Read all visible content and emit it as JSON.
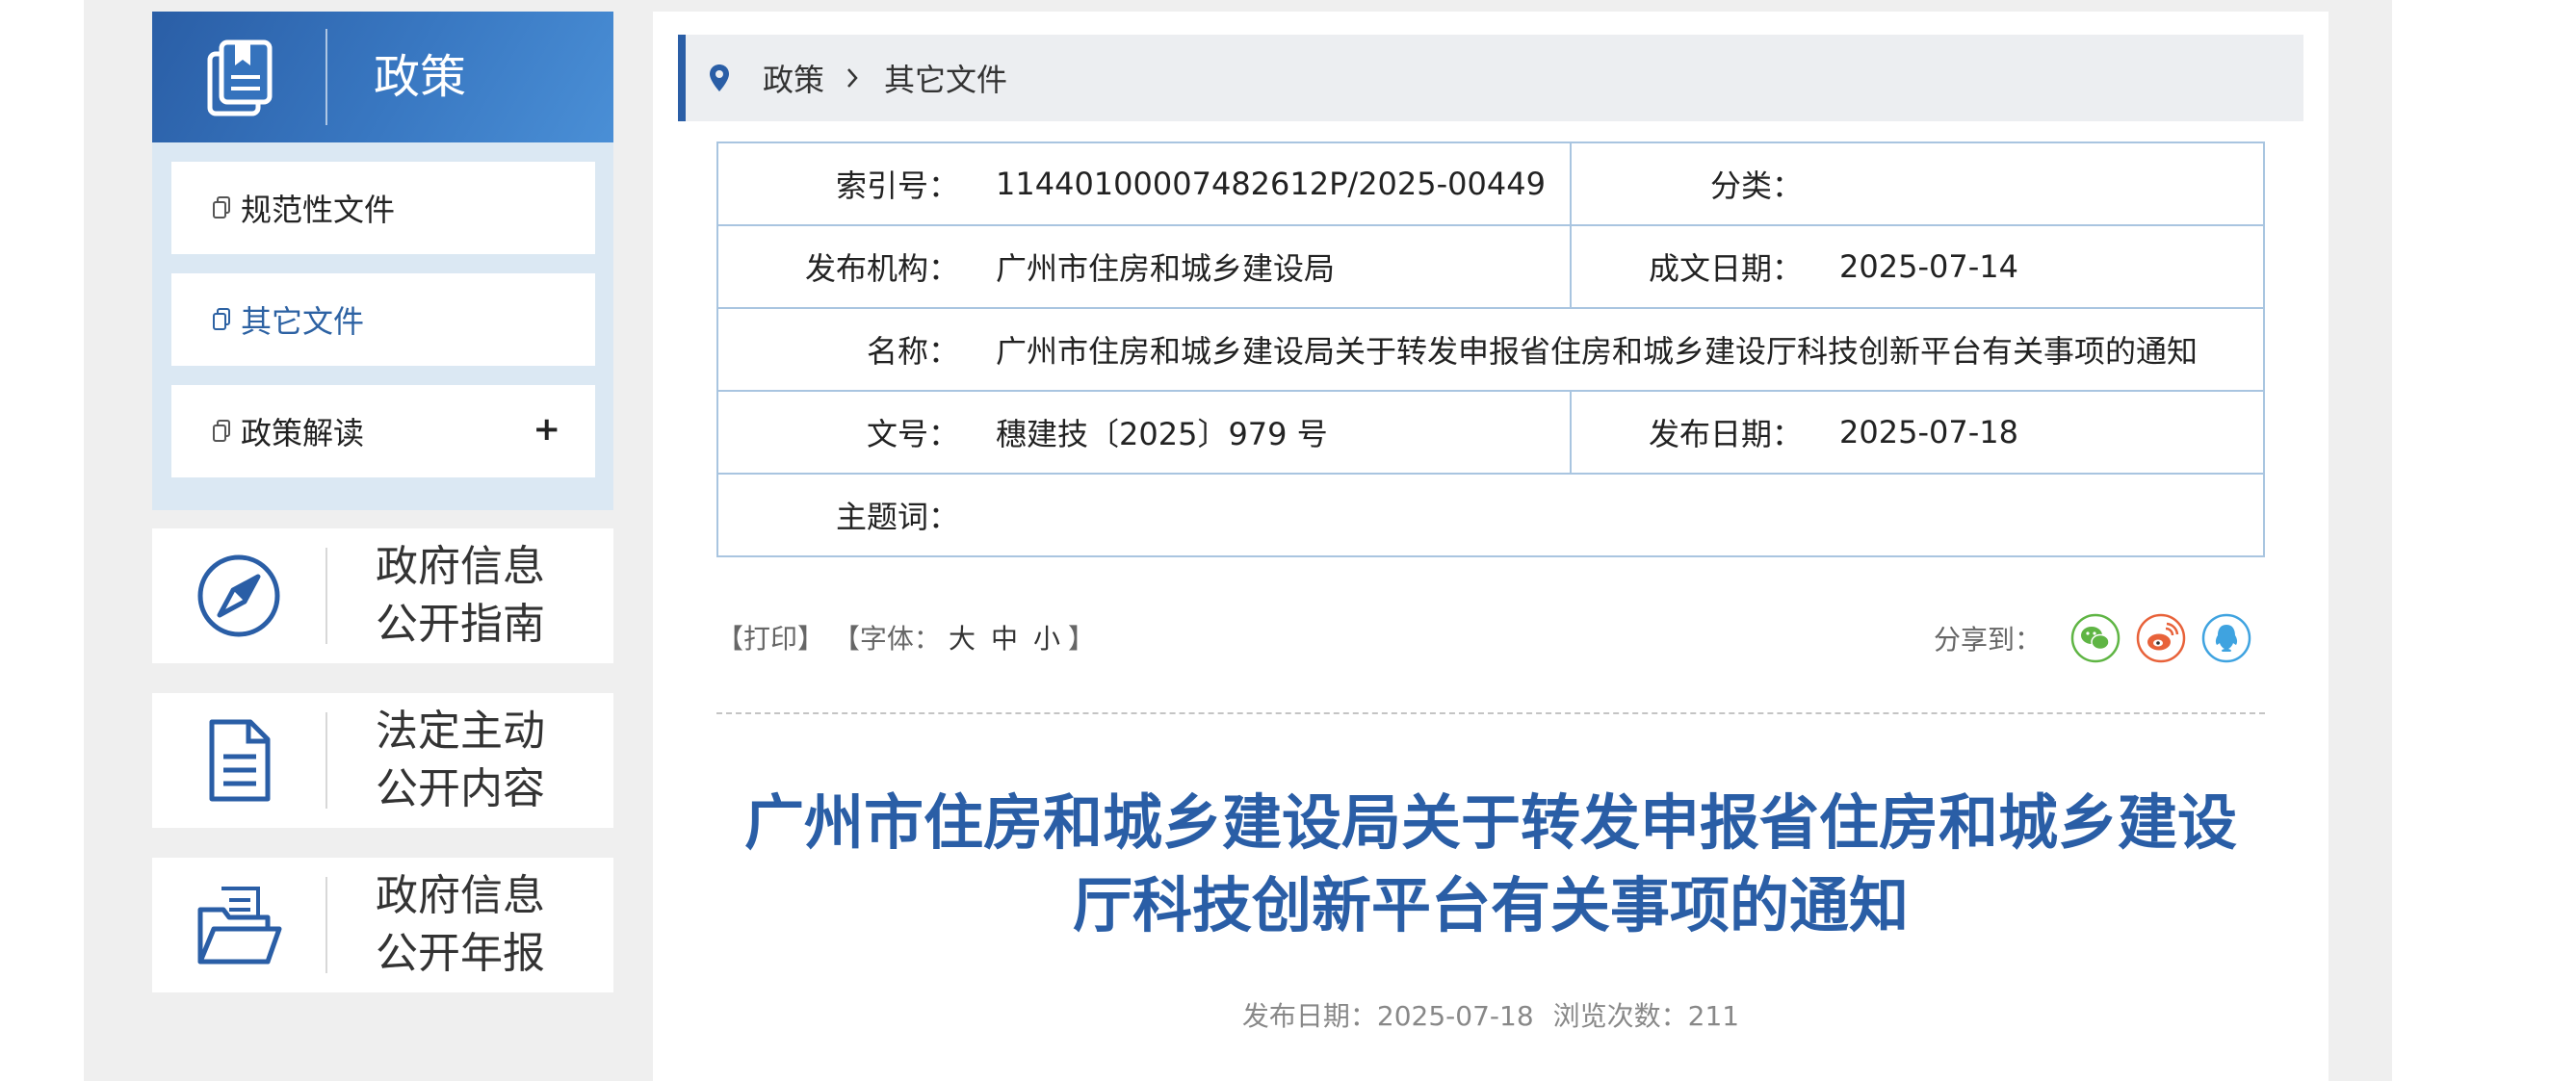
{
  "sidebar": {
    "header_title": "政策",
    "menu": [
      {
        "label": "规范性文件"
      },
      {
        "label": "其它文件"
      },
      {
        "label": "政策解读",
        "expand_symbol": "+"
      }
    ],
    "cards": [
      {
        "line1": "政府信息",
        "line2": "公开指南"
      },
      {
        "line1": "法定主动",
        "line2": "公开内容"
      },
      {
        "line1": "政府信息",
        "line2": "公开年报"
      }
    ]
  },
  "breadcrumb": {
    "root": "政策",
    "current": "其它文件"
  },
  "meta": {
    "index_label": "索引号：",
    "index_value": "11440100007482612P/2025-00449",
    "category_label": "分类：",
    "category_value": "",
    "publisher_label": "发布机构：",
    "publisher_value": "广州市住房和城乡建设局",
    "written_label": "成文日期：",
    "written_value": "2025-07-14",
    "name_label": "名称：",
    "name_value": "广州市住房和城乡建设局关于转发申报省住房和城乡建设厅科技创新平台有关事项的通知",
    "docno_label": "文号：",
    "docno_value": "穗建技〔2025〕979 号",
    "pubdate_label": "发布日期：",
    "pubdate_value": "2025-07-18",
    "subject_label": "主题词：",
    "subject_value": ""
  },
  "tools": {
    "print": "【打印】",
    "font_prefix": "【字体：",
    "font_large": "大",
    "font_medium": "中",
    "font_small": "小",
    "font_suffix": "】",
    "share_label": "分享到："
  },
  "article": {
    "title_line1": "广州市住房和城乡建设局关于转发申报省住房和城乡建设",
    "title_line2": "厅科技创新平台有关事项的通知",
    "date_label": "发布日期：",
    "date_value": "2025-07-18",
    "views_label": "浏览次数：",
    "views_value": "211"
  },
  "colors": {
    "brand_blue": "#2a5ea6",
    "wechat": "#5fb544",
    "weibo": "#e8623a",
    "qq": "#3fa3e0"
  }
}
